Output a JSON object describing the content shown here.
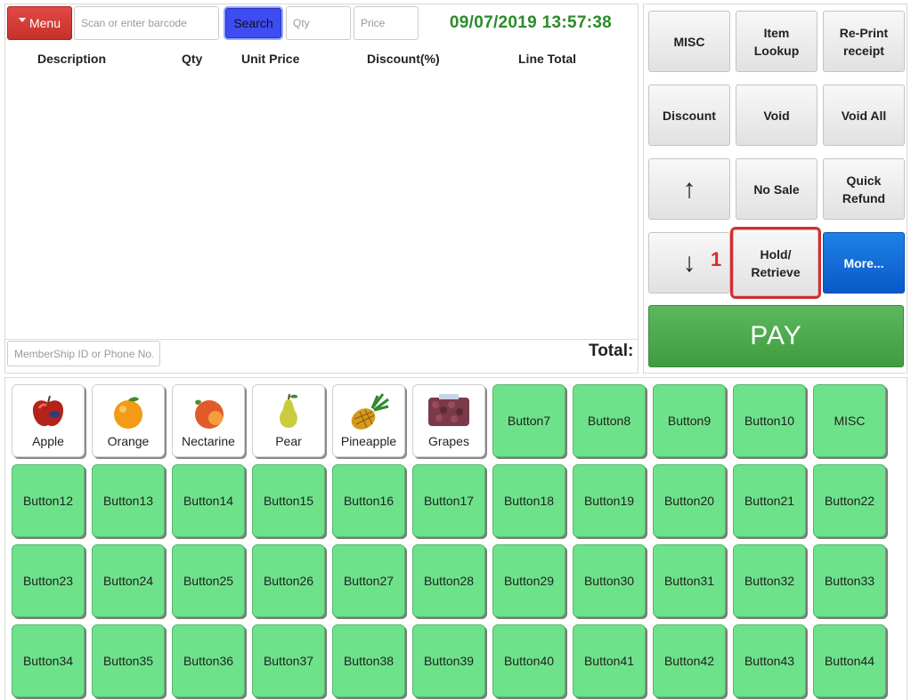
{
  "toolbar": {
    "menu_label": "Menu",
    "barcode_placeholder": "Scan or enter barcode",
    "search_label": "Search",
    "qty_placeholder": "Qty",
    "price_placeholder": "Price",
    "datetime": "09/07/2019 13:57:38"
  },
  "order_table": {
    "columns": [
      "Description",
      "Qty",
      "Unit Price",
      "Discount(%)",
      "Line Total"
    ]
  },
  "footer": {
    "member_placeholder": "MemberShip ID or Phone No.",
    "total_label": "Total:"
  },
  "functions": {
    "misc": "MISC",
    "item_lookup": "Item\nLookup",
    "reprint": "Re-Print\nreceipt",
    "discount": "Discount",
    "void": "Void",
    "void_all": "Void All",
    "up_arrow": "↑",
    "no_sale": "No Sale",
    "quick_refund": "Quick\nRefund",
    "down_arrow": "↓",
    "hold_retrieve": "Hold/\nRetrieve",
    "more": "More...",
    "badge": "1",
    "pay": "PAY"
  },
  "products": [
    {
      "label": "Apple",
      "icon": "apple-icon"
    },
    {
      "label": "Orange",
      "icon": "orange-icon"
    },
    {
      "label": "Nectarine",
      "icon": "nectarine-icon"
    },
    {
      "label": "Pear",
      "icon": "pear-icon"
    },
    {
      "label": "Pineapple",
      "icon": "pineapple-icon"
    },
    {
      "label": "Grapes",
      "icon": "grapes-icon"
    }
  ],
  "grid_buttons": [
    "Button7",
    "Button8",
    "Button9",
    "Button10",
    "MISC",
    "Button12",
    "Button13",
    "Button14",
    "Button15",
    "Button16",
    "Button17",
    "Button18",
    "Button19",
    "Button20",
    "Button21",
    "Button22",
    "Button23",
    "Button24",
    "Button25",
    "Button26",
    "Button27",
    "Button28",
    "Button29",
    "Button30",
    "Button31",
    "Button32",
    "Button33",
    "Button34",
    "Button35",
    "Button36",
    "Button37",
    "Button38",
    "Button39",
    "Button40",
    "Button41",
    "Button42",
    "Button43",
    "Button44"
  ],
  "colors": {
    "menu": "#c8302b",
    "search": "#3d4df2",
    "datetime": "#2a8c2a",
    "pay": "#4caf50",
    "more": "#0a58c7",
    "grid_green": "#6ee28a",
    "highlight": "#d52d2d"
  }
}
